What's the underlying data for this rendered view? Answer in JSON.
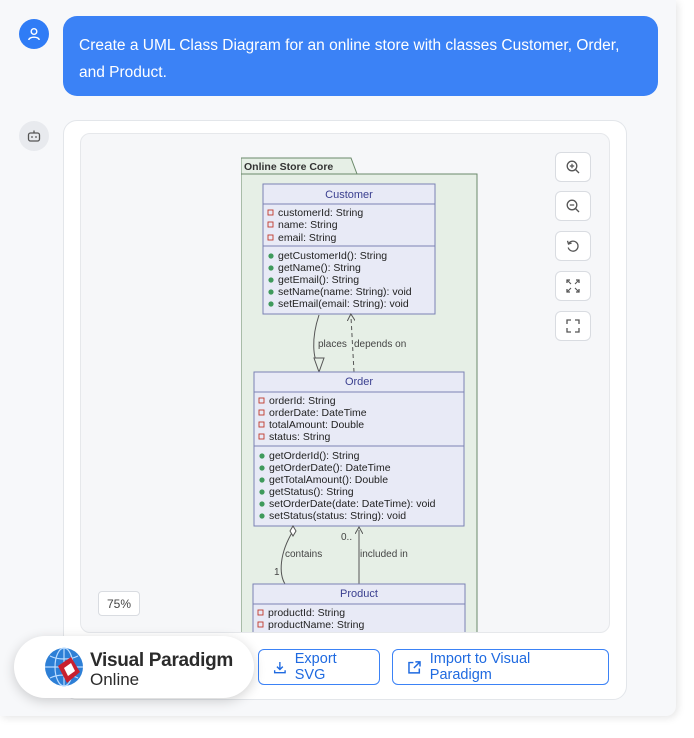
{
  "user_message": {
    "line1": "Create a UML Class Diagram for an online store with classes Customer, Order,",
    "line2": "and Product."
  },
  "diagram": {
    "package": "Online Store Core",
    "classes": {
      "customer": {
        "name": "Customer",
        "attributes": [
          "customerId: String",
          "name: String",
          "email: String"
        ],
        "methods": [
          "getCustomerId(): String",
          "getName(): String",
          "getEmail(): String",
          "setName(name: String): void",
          "setEmail(email: String): void"
        ]
      },
      "order": {
        "name": "Order",
        "attributes": [
          "orderId: String",
          "orderDate: DateTime",
          "totalAmount: Double",
          "status: String"
        ],
        "methods": [
          "getOrderId(): String",
          "getOrderDate(): DateTime",
          "getTotalAmount(): Double",
          "getStatus(): String",
          "setOrderDate(date: DateTime): void",
          "setStatus(status: String): void"
        ]
      },
      "product": {
        "name": "Product",
        "attributes": [
          "productId: String",
          "productName: String"
        ]
      }
    },
    "relations": {
      "places": "places",
      "depends_on": "depends on",
      "contains": "contains",
      "included_in": "included in",
      "mult_one": "1",
      "mult_many": "0.."
    }
  },
  "viewer": {
    "zoom_level": "75%",
    "controls": [
      "zoom-in-icon",
      "zoom-out-icon",
      "reset-icon",
      "fit-icon",
      "fullscreen-icon"
    ]
  },
  "actions": {
    "export_svg": "Export SVG",
    "import_vp": "Import to Visual Paradigm"
  },
  "brand": {
    "line1": "Visual Paradigm",
    "line2": "Online"
  },
  "colors": {
    "accent": "#3b82f6",
    "class_fill": "#e8eaf6",
    "class_border": "#7b82b4",
    "package_fill": "#e6efe6",
    "package_border": "#6b8a6b"
  }
}
